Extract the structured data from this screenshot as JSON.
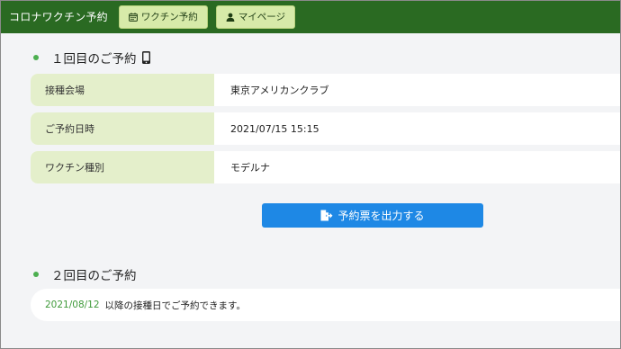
{
  "header": {
    "app_title": "コロナワクチン予約",
    "nav": [
      {
        "label": "ワクチン予約",
        "icon": "calendar-icon"
      },
      {
        "label": "マイページ",
        "icon": "user-icon"
      }
    ],
    "colors": {
      "bar": "#2a6a22",
      "nav_bg": "#d7eaa9"
    }
  },
  "first": {
    "title": "１回目のご予約",
    "icon": "mobile-phone-icon",
    "rows": [
      {
        "label": "接種会場",
        "value": "東京アメリカンクラブ"
      },
      {
        "label": "ご予約日時",
        "value": "2021/07/15 15:15"
      },
      {
        "label": "ワクチン種別",
        "value": "モデルナ"
      }
    ],
    "print_label": "予約票を出力する",
    "print_icon": "file-export-icon"
  },
  "second": {
    "title": "２回目のご予約",
    "date": "2021/08/12",
    "text": "以降の接種日でご予約できます。"
  },
  "colors": {
    "accent_green": "#4caf50",
    "label_bg": "#e4efcb",
    "button_blue": "#1e88e5"
  }
}
